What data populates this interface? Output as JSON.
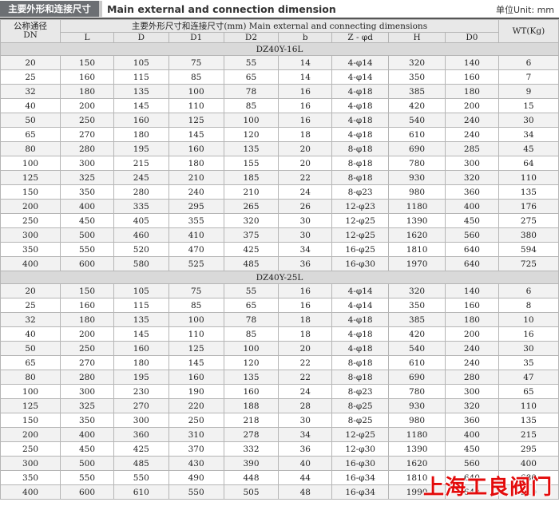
{
  "header": {
    "title_cn": "主要外形和连接尺寸",
    "title_en": "Main external and connection dimension",
    "unit": "单位Unit: mm"
  },
  "table": {
    "dn_header_cn": "公称通径",
    "dn_header": "DN",
    "group_header": "主要外形尺寸和连接尺寸(mm) Main external and connecting dimensions",
    "columns": [
      "L",
      "D",
      "D1",
      "D2",
      "b",
      "Z - φd",
      "H",
      "D0"
    ],
    "wt_header": "WT(Kg)",
    "sections": [
      {
        "title": "DZ40Y-16L",
        "rows": [
          [
            "20",
            "150",
            "105",
            "75",
            "55",
            "14",
            "4-φ14",
            "320",
            "140",
            "6"
          ],
          [
            "25",
            "160",
            "115",
            "85",
            "65",
            "14",
            "4-φ14",
            "350",
            "160",
            "7"
          ],
          [
            "32",
            "180",
            "135",
            "100",
            "78",
            "16",
            "4-φ18",
            "385",
            "180",
            "9"
          ],
          [
            "40",
            "200",
            "145",
            "110",
            "85",
            "16",
            "4-φ18",
            "420",
            "200",
            "15"
          ],
          [
            "50",
            "250",
            "160",
            "125",
            "100",
            "16",
            "4-φ18",
            "540",
            "240",
            "30"
          ],
          [
            "65",
            "270",
            "180",
            "145",
            "120",
            "18",
            "4-φ18",
            "610",
            "240",
            "34"
          ],
          [
            "80",
            "280",
            "195",
            "160",
            "135",
            "20",
            "8-φ18",
            "690",
            "285",
            "45"
          ],
          [
            "100",
            "300",
            "215",
            "180",
            "155",
            "20",
            "8-φ18",
            "780",
            "300",
            "64"
          ],
          [
            "125",
            "325",
            "245",
            "210",
            "185",
            "22",
            "8-φ18",
            "930",
            "320",
            "110"
          ],
          [
            "150",
            "350",
            "280",
            "240",
            "210",
            "24",
            "8-φ23",
            "980",
            "360",
            "135"
          ],
          [
            "200",
            "400",
            "335",
            "295",
            "265",
            "26",
            "12-φ23",
            "1180",
            "400",
            "176"
          ],
          [
            "250",
            "450",
            "405",
            "355",
            "320",
            "30",
            "12-φ25",
            "1390",
            "450",
            "275"
          ],
          [
            "300",
            "500",
            "460",
            "410",
            "375",
            "30",
            "12-φ25",
            "1620",
            "560",
            "380"
          ],
          [
            "350",
            "550",
            "520",
            "470",
            "425",
            "34",
            "16-φ25",
            "1810",
            "640",
            "594"
          ],
          [
            "400",
            "600",
            "580",
            "525",
            "485",
            "36",
            "16-φ30",
            "1970",
            "640",
            "725"
          ]
        ]
      },
      {
        "title": "DZ40Y-25L",
        "rows": [
          [
            "20",
            "150",
            "105",
            "75",
            "55",
            "16",
            "4-φ14",
            "320",
            "140",
            "6"
          ],
          [
            "25",
            "160",
            "115",
            "85",
            "65",
            "16",
            "4-φ14",
            "350",
            "160",
            "8"
          ],
          [
            "32",
            "180",
            "135",
            "100",
            "78",
            "18",
            "4-φ18",
            "385",
            "180",
            "10"
          ],
          [
            "40",
            "200",
            "145",
            "110",
            "85",
            "18",
            "4-φ18",
            "420",
            "200",
            "16"
          ],
          [
            "50",
            "250",
            "160",
            "125",
            "100",
            "20",
            "4-φ18",
            "540",
            "240",
            "30"
          ],
          [
            "65",
            "270",
            "180",
            "145",
            "120",
            "22",
            "8-φ18",
            "610",
            "240",
            "35"
          ],
          [
            "80",
            "280",
            "195",
            "160",
            "135",
            "22",
            "8-φ18",
            "690",
            "280",
            "47"
          ],
          [
            "100",
            "300",
            "230",
            "190",
            "160",
            "24",
            "8-φ23",
            "780",
            "300",
            "65"
          ],
          [
            "125",
            "325",
            "270",
            "220",
            "188",
            "28",
            "8-φ25",
            "930",
            "320",
            "110"
          ],
          [
            "150",
            "350",
            "300",
            "250",
            "218",
            "30",
            "8-φ25",
            "980",
            "360",
            "135"
          ],
          [
            "200",
            "400",
            "360",
            "310",
            "278",
            "34",
            "12-φ25",
            "1180",
            "400",
            "215"
          ],
          [
            "250",
            "450",
            "425",
            "370",
            "332",
            "36",
            "12-φ30",
            "1390",
            "450",
            "295"
          ],
          [
            "300",
            "500",
            "485",
            "430",
            "390",
            "40",
            "16-φ30",
            "1620",
            "560",
            "400"
          ],
          [
            "350",
            "550",
            "550",
            "490",
            "448",
            "44",
            "16-φ34",
            "1810",
            "640",
            "680"
          ],
          [
            "400",
            "600",
            "610",
            "550",
            "505",
            "48",
            "16-φ34",
            "1990",
            "640",
            "910"
          ]
        ]
      }
    ]
  },
  "watermark": "上海工良阀门"
}
